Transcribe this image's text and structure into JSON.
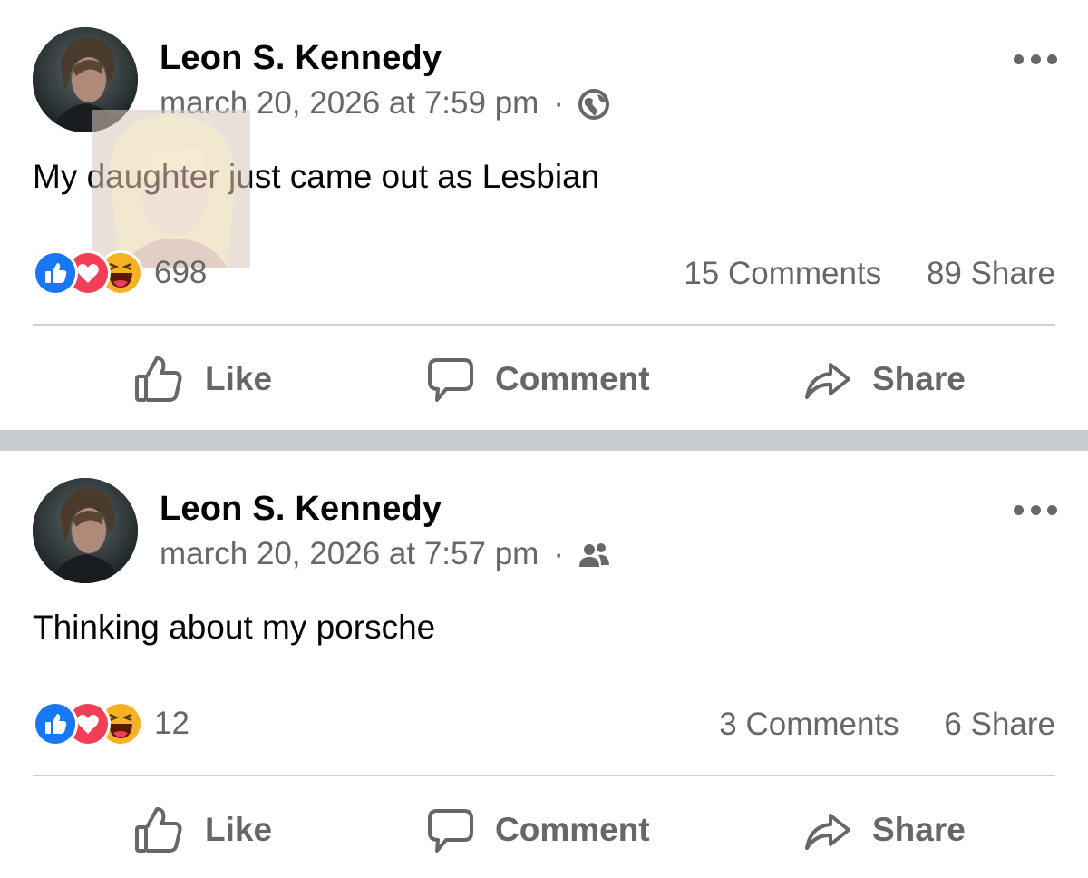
{
  "posts": [
    {
      "author": "Leon S. Kennedy",
      "timestamp": "march 20, 2026 at 7:59 pm",
      "separator": "·",
      "audience_icon": "globe-icon",
      "text": "My daughter just came out as Lesbian",
      "reaction_count": "698",
      "comments": "15 Comments",
      "shares": "89 Share",
      "actions": {
        "like": "Like",
        "comment": "Comment",
        "share": "Share"
      }
    },
    {
      "author": "Leon S. Kennedy",
      "timestamp": "march 20, 2026 at 7:57 pm",
      "separator": "·",
      "audience_icon": "friends-icon",
      "text": "Thinking about my porsche",
      "reaction_count": "12",
      "comments": "3 Comments",
      "shares": "6 Share",
      "actions": {
        "like": "Like",
        "comment": "Comment",
        "share": "Share"
      }
    }
  ],
  "colors": {
    "like": "#1877f2",
    "love": "#f33e58",
    "haha": "#f7b125",
    "separator": "#c9ccd1",
    "secondary_text": "#65676b"
  }
}
